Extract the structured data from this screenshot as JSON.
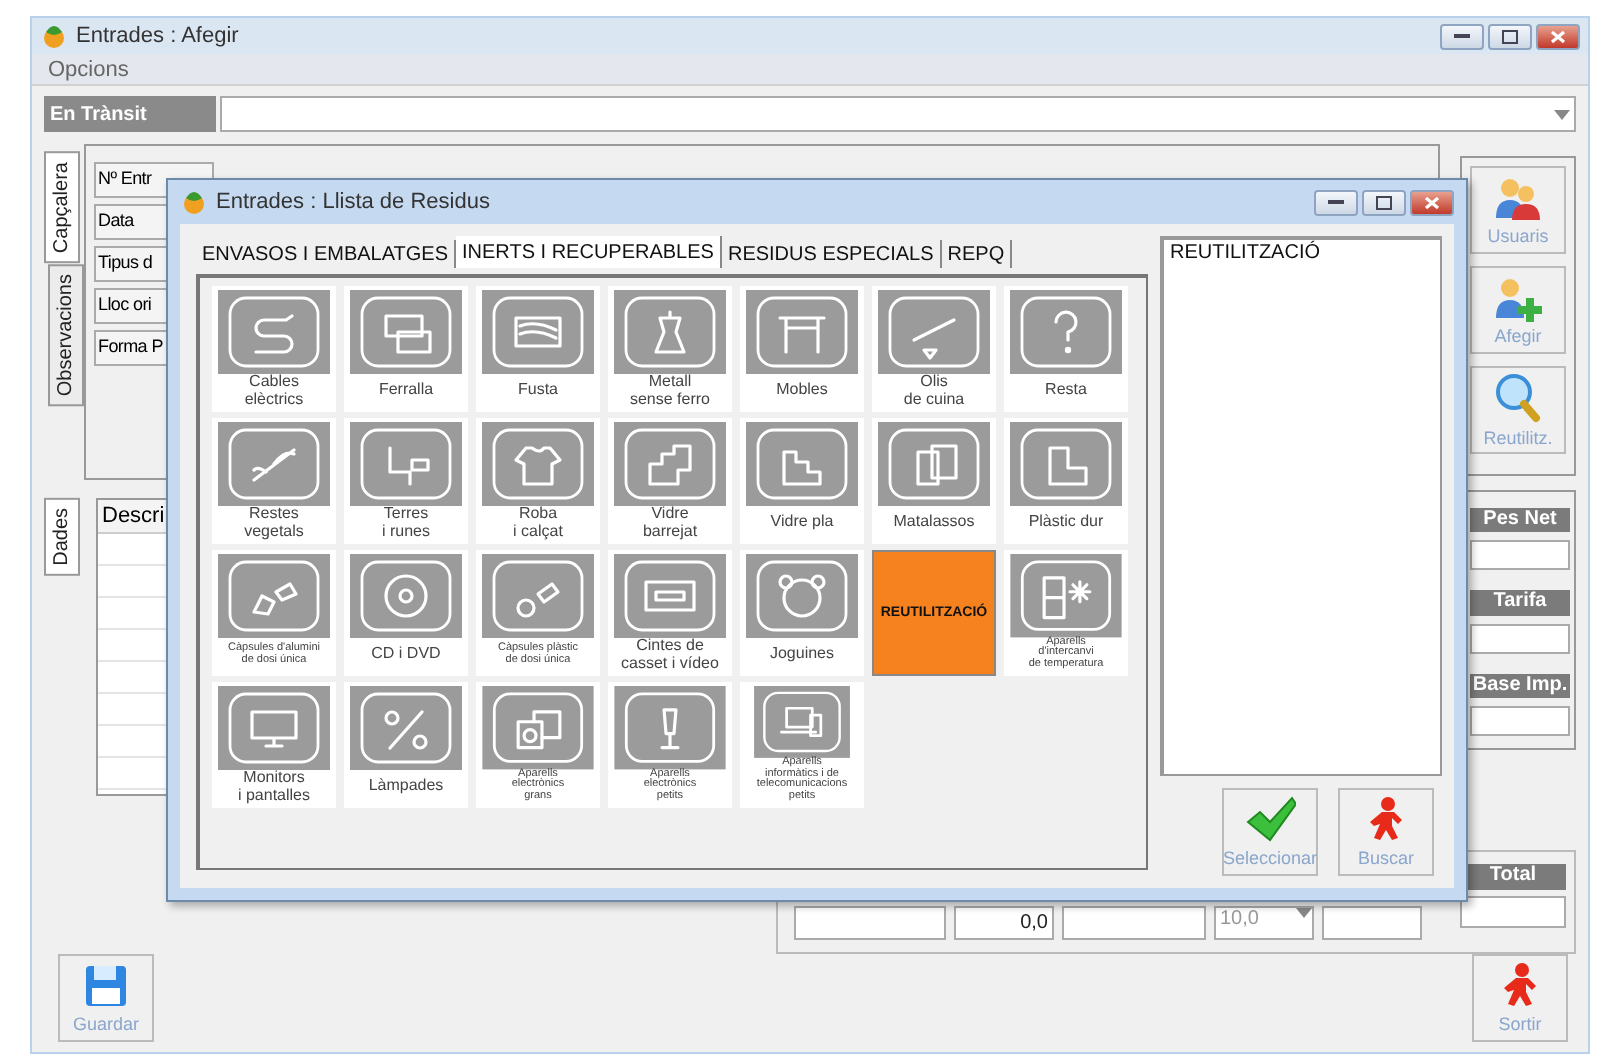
{
  "window": {
    "title": "Entrades : Afegir"
  },
  "menu": [
    "Opcions"
  ],
  "transit": {
    "label": "En Trànsit"
  },
  "side_tabs": [
    {
      "label": "Capçalera",
      "selected": true
    },
    {
      "label": "Observacions",
      "selected": false
    }
  ],
  "header_fields": [
    "Nº Entr",
    "Data",
    "Tipus d",
    "Lloc ori",
    "Forma P"
  ],
  "actions": [
    "Usuaris",
    "Afegir",
    "Reutilitz."
  ],
  "data_tabs": [
    {
      "label": "Dades",
      "selected": true
    }
  ],
  "table": {
    "columns": [
      "Descri"
    ]
  },
  "amount_labels": [
    "Pes Net",
    "Tarifa",
    "Base Imp."
  ],
  "bottom_fields": [
    {
      "kind": "text"
    },
    {
      "kind": "text",
      "value": "0,0"
    },
    {
      "kind": "text"
    },
    {
      "kind": "dropdown",
      "value": "10,0",
      "disabled": true
    },
    {
      "kind": "text"
    }
  ],
  "total": {
    "label": "Total"
  },
  "footer": {
    "save": "Guardar",
    "exit": "Sortir"
  },
  "dialog": {
    "title": "Entrades : Llista de Residus",
    "tabs": [
      {
        "label": "ENVASOS I EMBALATGES",
        "selected": false
      },
      {
        "label": "INERTS I RECUPERABLES",
        "selected": true
      },
      {
        "label": "RESIDUS ESPECIALS",
        "selected": false
      },
      {
        "label": "REPQ",
        "selected": false
      }
    ],
    "tiles": [
      {
        "kind": "icon",
        "label": "Cables\nelèctrics",
        "selected": false
      },
      {
        "kind": "icon",
        "label": "Ferralla",
        "selected": false
      },
      {
        "kind": "icon",
        "label": "Fusta",
        "selected": false
      },
      {
        "kind": "icon",
        "label": "Metall\nsense ferro",
        "selected": false
      },
      {
        "kind": "icon",
        "label": "Mobles",
        "selected": false
      },
      {
        "kind": "icon",
        "label": "Olis\nde cuina",
        "selected": false
      },
      {
        "kind": "icon",
        "label": "Resta",
        "selected": false
      },
      {
        "kind": "icon",
        "label": "Restes\nvegetals",
        "selected": false
      },
      {
        "kind": "icon",
        "label": "Terres\ni runes",
        "selected": false
      },
      {
        "kind": "icon",
        "label": "Roba\ni calçat",
        "selected": false
      },
      {
        "kind": "icon",
        "label": "Vidre\nbarrejat",
        "selected": false
      },
      {
        "kind": "icon",
        "label": "Vidre pla",
        "selected": false
      },
      {
        "kind": "icon",
        "label": "Matalassos",
        "selected": false
      },
      {
        "kind": "icon",
        "label": "Plàstic dur",
        "selected": false
      },
      {
        "kind": "icon-small",
        "label": "Càpsules d'alumini\nde dosi única",
        "selected": false
      },
      {
        "kind": "icon",
        "label": "CD i DVD",
        "selected": false
      },
      {
        "kind": "icon-small",
        "label": "Càpsules plàstic\nde dosi única",
        "selected": false
      },
      {
        "kind": "icon",
        "label": "Cintes de\ncasset i vídeo",
        "selected": false
      },
      {
        "kind": "icon",
        "label": "Joguines",
        "selected": false
      },
      {
        "kind": "text",
        "label": "REUTILITZACIÓ",
        "selected": true
      },
      {
        "kind": "icon-small",
        "label": "Aparells\nd'intercanvi\nde temperatura",
        "selected": false
      },
      {
        "kind": "icon",
        "label": "Monitors\ni pantalles",
        "selected": false
      },
      {
        "kind": "icon",
        "label": "Làmpades",
        "selected": false
      },
      {
        "kind": "icon-small",
        "label": "Aparells\nelectrònics\ngrans",
        "selected": false
      },
      {
        "kind": "icon-small",
        "label": "Aparells\nelectrònics\npetits",
        "selected": false
      },
      {
        "kind": "icon-small",
        "label": "Aparells\ninformàtics i de\ntelecomunicacions\npetits",
        "selected": false
      }
    ],
    "list": [
      "REUTILITZACIÓ"
    ],
    "buttons": [
      "Seleccionar",
      "Buscar"
    ]
  }
}
